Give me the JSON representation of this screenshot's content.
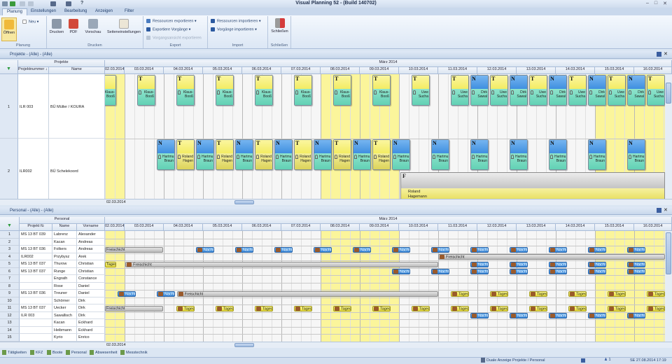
{
  "window": {
    "title": "Visual Planning 52 - (Build 140702)",
    "help": "?",
    "controls": [
      "–",
      "□",
      "✕"
    ]
  },
  "tabs": [
    "Planung",
    "Einstellungen",
    "Bearbeitung",
    "Anzeigen",
    "Filter"
  ],
  "ribbon": {
    "planung": {
      "label": "Planung",
      "open": "Öffnen",
      "new": "Neu"
    },
    "drucken": {
      "label": "Drucken",
      "print": "Drucken",
      "pdf": "PDF",
      "preview": "Vorschau",
      "page_setup": "Seiteneinstellungen"
    },
    "export": {
      "label": "Export",
      "items": [
        "Ressourcen exportieren",
        "Exportiere Vorgänge",
        "Vorgangsansicht exportieren"
      ]
    },
    "import": {
      "label": "Import",
      "items": [
        "Ressourcen importieren",
        "Vorgänge importieren"
      ]
    },
    "schliessen": {
      "label": "Schließen",
      "close": "Schließen"
    }
  },
  "month": "März 2014",
  "dates": [
    "02.03.2014",
    "03.03.2014",
    "04.03.2014",
    "05.03.2014",
    "06.03.2014",
    "07.03.2014",
    "08.03.2014",
    "09.03.2014",
    "10.03.2014",
    "11.03.2014",
    "12.03.2014",
    "13.03.2014",
    "14.03.2014",
    "15.03.2014",
    "16.03.2014"
  ],
  "weekend_dates": [
    "02.03.2014",
    "08.03.2014",
    "09.03.2014",
    "15.03.2014",
    "16.03.2014"
  ],
  "colors": {
    "weekend": "#fbf59b",
    "T": "#f3ec63",
    "N": "#3f8fe0",
    "resource": "#62d1b5",
    "F": "#c4c4c4",
    "nacht": "#2f7fd3",
    "tagesdienst": "#efe65a",
    "freischicht": "#bdbdbd"
  },
  "projects": {
    "pane_title": "Projekte - (Alle) - (Alle)",
    "group_header": "Projekte",
    "columns": [
      "Projektnummer",
      "Name"
    ],
    "sort_icon": "sort-az-icon",
    "rows": [
      {
        "num": "1",
        "projektnummer": "ILR 003",
        "name": "BÜ Müller / KOURA"
      },
      {
        "num": "2",
        "projektnummer": "ILR002",
        "name": "BÜ Schelekoord"
      }
    ],
    "cards": [
      {
        "row": 0,
        "date": "02.03.2014",
        "shift": "früh",
        "type": "T",
        "l1": "Klaus-",
        "l2": "Booß"
      },
      {
        "row": 0,
        "date": "03.03.2014",
        "shift": "früh",
        "type": "T",
        "l1": "Klaus-",
        "l2": "Booß"
      },
      {
        "row": 0,
        "date": "04.03.2014",
        "shift": "früh",
        "type": "T",
        "l1": "Klaus-",
        "l2": "Booß"
      },
      {
        "row": 0,
        "date": "05.03.2014",
        "shift": "früh",
        "type": "T",
        "l1": "Klaus-",
        "l2": "Booß"
      },
      {
        "row": 0,
        "date": "06.03.2014",
        "shift": "früh",
        "type": "T",
        "l1": "Klaus-",
        "l2": "Booß"
      },
      {
        "row": 0,
        "date": "07.03.2014",
        "shift": "früh",
        "type": "T",
        "l1": "Klaus-",
        "l2": "Booß"
      },
      {
        "row": 0,
        "date": "08.03.2014",
        "shift": "früh",
        "type": "T",
        "l1": "Klaus-",
        "l2": "Booß"
      },
      {
        "row": 0,
        "date": "09.03.2014",
        "shift": "früh",
        "type": "T",
        "l1": "Klaus-",
        "l2": "Booß"
      },
      {
        "row": 0,
        "date": "10.03.2014",
        "shift": "früh",
        "type": "T",
        "l1": "Uwe",
        "l2": "Sucha"
      },
      {
        "row": 0,
        "date": "11.03.2014",
        "shift": "früh",
        "type": "T",
        "l1": "Uwe",
        "l2": "Sucha"
      },
      {
        "row": 0,
        "date": "11.03.2014",
        "shift": "spät",
        "type": "N",
        "l1": "Dirk",
        "l2": "Sawal"
      },
      {
        "row": 0,
        "date": "12.03.2014",
        "shift": "früh",
        "type": "T",
        "l1": "Uwe",
        "l2": "Sucha"
      },
      {
        "row": 0,
        "date": "12.03.2014",
        "shift": "spät",
        "type": "N",
        "l1": "Dirk",
        "l2": "Sawal"
      },
      {
        "row": 0,
        "date": "13.03.2014",
        "shift": "früh",
        "type": "T",
        "l1": "Uwe",
        "l2": "Sucha"
      },
      {
        "row": 0,
        "date": "13.03.2014",
        "shift": "spät",
        "type": "N",
        "l1": "Dirk",
        "l2": "Sawal"
      },
      {
        "row": 0,
        "date": "14.03.2014",
        "shift": "früh",
        "type": "T",
        "l1": "Uwe",
        "l2": "Sucha"
      },
      {
        "row": 0,
        "date": "14.03.2014",
        "shift": "spät",
        "type": "N",
        "l1": "Dirk",
        "l2": "Sawal"
      },
      {
        "row": 0,
        "date": "15.03.2014",
        "shift": "früh",
        "type": "T",
        "l1": "Uwe",
        "l2": "Sucha"
      },
      {
        "row": 0,
        "date": "15.03.2014",
        "shift": "spät",
        "type": "N",
        "l1": "Dirk",
        "l2": "Sawal"
      },
      {
        "row": 0,
        "date": "16.03.2014",
        "shift": "früh",
        "type": "T",
        "l1": "Uwe",
        "l2": "Sucha"
      },
      {
        "row": 1,
        "date": "03.03.2014",
        "shift": "spät",
        "type": "N",
        "l1": "Hartmu",
        "l2": "Braun"
      },
      {
        "row": 1,
        "date": "04.03.2014",
        "shift": "früh",
        "type": "T",
        "l1": "Roland",
        "l2": "Hagen"
      },
      {
        "row": 1,
        "date": "04.03.2014",
        "shift": "spät",
        "type": "N",
        "l1": "Hartmu",
        "l2": "Braun"
      },
      {
        "row": 1,
        "date": "05.03.2014",
        "shift": "früh",
        "type": "T",
        "l1": "Roland",
        "l2": "Hagen"
      },
      {
        "row": 1,
        "date": "05.03.2014",
        "shift": "spät",
        "type": "N",
        "l1": "Hartmu",
        "l2": "Braun"
      },
      {
        "row": 1,
        "date": "06.03.2014",
        "shift": "früh",
        "type": "T",
        "l1": "Roland",
        "l2": "Hagen"
      },
      {
        "row": 1,
        "date": "06.03.2014",
        "shift": "spät",
        "type": "N",
        "l1": "Hartmu",
        "l2": "Braun"
      },
      {
        "row": 1,
        "date": "07.03.2014",
        "shift": "früh",
        "type": "T",
        "l1": "Roland",
        "l2": "Hagen"
      },
      {
        "row": 1,
        "date": "07.03.2014",
        "shift": "spät",
        "type": "N",
        "l1": "Hartmu",
        "l2": "Braun"
      },
      {
        "row": 1,
        "date": "08.03.2014",
        "shift": "früh",
        "type": "T",
        "l1": "Roland",
        "l2": "Hagen"
      },
      {
        "row": 1,
        "date": "08.03.2014",
        "shift": "spät",
        "type": "N",
        "l1": "Hartmu",
        "l2": "Braun"
      },
      {
        "row": 1,
        "date": "09.03.2014",
        "shift": "früh",
        "type": "T",
        "l1": "Roland",
        "l2": "Hagen"
      },
      {
        "row": 1,
        "date": "09.03.2014",
        "shift": "spät",
        "type": "N",
        "l1": "Hartmu",
        "l2": "Braun"
      },
      {
        "row": 1,
        "date": "10.03.2014",
        "shift": "spät",
        "type": "N",
        "l1": "Hartmu",
        "l2": "Braun"
      },
      {
        "row": 1,
        "date": "11.03.2014",
        "shift": "spät",
        "type": "N",
        "l1": "Hartmu",
        "l2": "Braun"
      },
      {
        "row": 1,
        "date": "12.03.2014",
        "shift": "spät",
        "type": "N",
        "l1": "Hartmu",
        "l2": "Braun"
      },
      {
        "row": 1,
        "date": "13.03.2014",
        "shift": "spät",
        "type": "N",
        "l1": "Hartmu",
        "l2": "Braun"
      },
      {
        "row": 1,
        "date": "14.03.2014",
        "shift": "spät",
        "type": "N",
        "l1": "Hartmu",
        "l2": "Braun"
      },
      {
        "row": 1,
        "date": "15.03.2014",
        "shift": "spät",
        "type": "N",
        "l1": "Hartmu",
        "l2": "Braun"
      }
    ],
    "long_task": {
      "row": 1,
      "from": "10.03.2014",
      "type": "F",
      "l1": "Roland",
      "l2": "Hagemann"
    },
    "scroll_date": "02.03.2014"
  },
  "personal": {
    "pane_title": "Personal - (Alle) - (Alle)",
    "group_header": "Personal",
    "columns": [
      "Projekt fü",
      "Name",
      "Vorname"
    ],
    "rows": [
      {
        "num": "1",
        "projekt": "MS 13 BT 039",
        "name": "Labrenz",
        "vorname": "Alexander"
      },
      {
        "num": "2",
        "projekt": "",
        "name": "Kacan",
        "vorname": "Andreas"
      },
      {
        "num": "3",
        "projekt": "MS 13 BT 036",
        "name": "Folkers",
        "vorname": "Andreas"
      },
      {
        "num": "4",
        "projekt": "ILR002",
        "name": "Przybysz",
        "vorname": "Arek"
      },
      {
        "num": "5",
        "projekt": "MS 13 BT 037",
        "name": "Thurow",
        "vorname": "Christian"
      },
      {
        "num": "6",
        "projekt": "MS 13 BT 037",
        "name": "Runge",
        "vorname": "Christian"
      },
      {
        "num": "7",
        "projekt": "",
        "name": "Engrath",
        "vorname": "Constance"
      },
      {
        "num": "8",
        "projekt": "",
        "name": "Rose",
        "vorname": "Daniel"
      },
      {
        "num": "9",
        "projekt": "MS 13 BT 036",
        "name": "Treuner",
        "vorname": "Daniel"
      },
      {
        "num": "10",
        "projekt": "",
        "name": "Schörner",
        "vorname": "Dirk"
      },
      {
        "num": "11",
        "projekt": "MS 13 BT 037",
        "name": "Uecker",
        "vorname": "Dirk"
      },
      {
        "num": "12",
        "projekt": "ILR 003",
        "name": "Sawallisch",
        "vorname": "Dirk"
      },
      {
        "num": "13",
        "projekt": "",
        "name": "Kacan",
        "vorname": "Eckhard"
      },
      {
        "num": "14",
        "projekt": "",
        "name": "Heibmann",
        "vorname": "Eckhard"
      },
      {
        "num": "15",
        "projekt": "",
        "name": "Kyrio",
        "vorname": "Enrico"
      }
    ],
    "labels": {
      "freischicht": "Freischicht",
      "nacht": "Nacht",
      "tagesdienst": "Tagesd"
    },
    "bars": [
      {
        "row": 2,
        "kind": "freischicht",
        "from": "02.03.2014 12:00",
        "to": "03.03.2014 23:30",
        "icon": false
      },
      {
        "row": 2,
        "kind": "nacht",
        "series_from": "05.03.2014",
        "series_to": "16.03.2014"
      },
      {
        "row": 3,
        "kind": "freischicht",
        "from": "11.03.2014 00:00",
        "to": "16.03.2014 23:59",
        "icon": true
      },
      {
        "row": 4,
        "kind": "tagesdienst",
        "from": "02.03.2014 12:00",
        "to": "02.03.2014 19:00",
        "icon": false
      },
      {
        "row": 4,
        "kind": "freischicht",
        "from": "03.03.2014 00:30",
        "to": "11.03.2014 00:00",
        "icon": true
      },
      {
        "row": 4,
        "kind": "nacht",
        "series_from": "12.03.2014",
        "series_to": "16.03.2014"
      },
      {
        "row": 5,
        "kind": "nacht",
        "series_from": "10.03.2014",
        "series_to": "16.03.2014"
      },
      {
        "row": 8,
        "kind": "nacht",
        "series_from": "03.03.2014",
        "series_to": "04.03.2014"
      },
      {
        "row": 8,
        "kind": "freischicht",
        "from": "04.03.2014 08:00",
        "to": "11.03.2014 00:00",
        "icon": true
      },
      {
        "row": 8,
        "kind": "tagesdienst",
        "series_from": "11.03.2014",
        "series_to": "16.03.2014"
      },
      {
        "row": 10,
        "kind": "freischicht",
        "from": "02.03.2014 12:00",
        "to": "03.03.2014 23:30",
        "icon": false
      },
      {
        "row": 10,
        "kind": "tagesdienst",
        "series_from": "04.03.2014",
        "series_to": "16.03.2014"
      },
      {
        "row": 11,
        "kind": "nacht",
        "series_from": "12.03.2014",
        "series_to": "16.03.2014"
      }
    ],
    "scroll_date": "02.03.2014"
  },
  "bottom_tabs": [
    "Tätigkeiten",
    "KFZ",
    "Boote",
    "Personal",
    "Abwesenheit",
    "Messtechnik"
  ],
  "status": {
    "view": "Duale Anzeige Projekte / Personal",
    "count": "1",
    "datetime": "SE 27.08.2014 17:19"
  }
}
